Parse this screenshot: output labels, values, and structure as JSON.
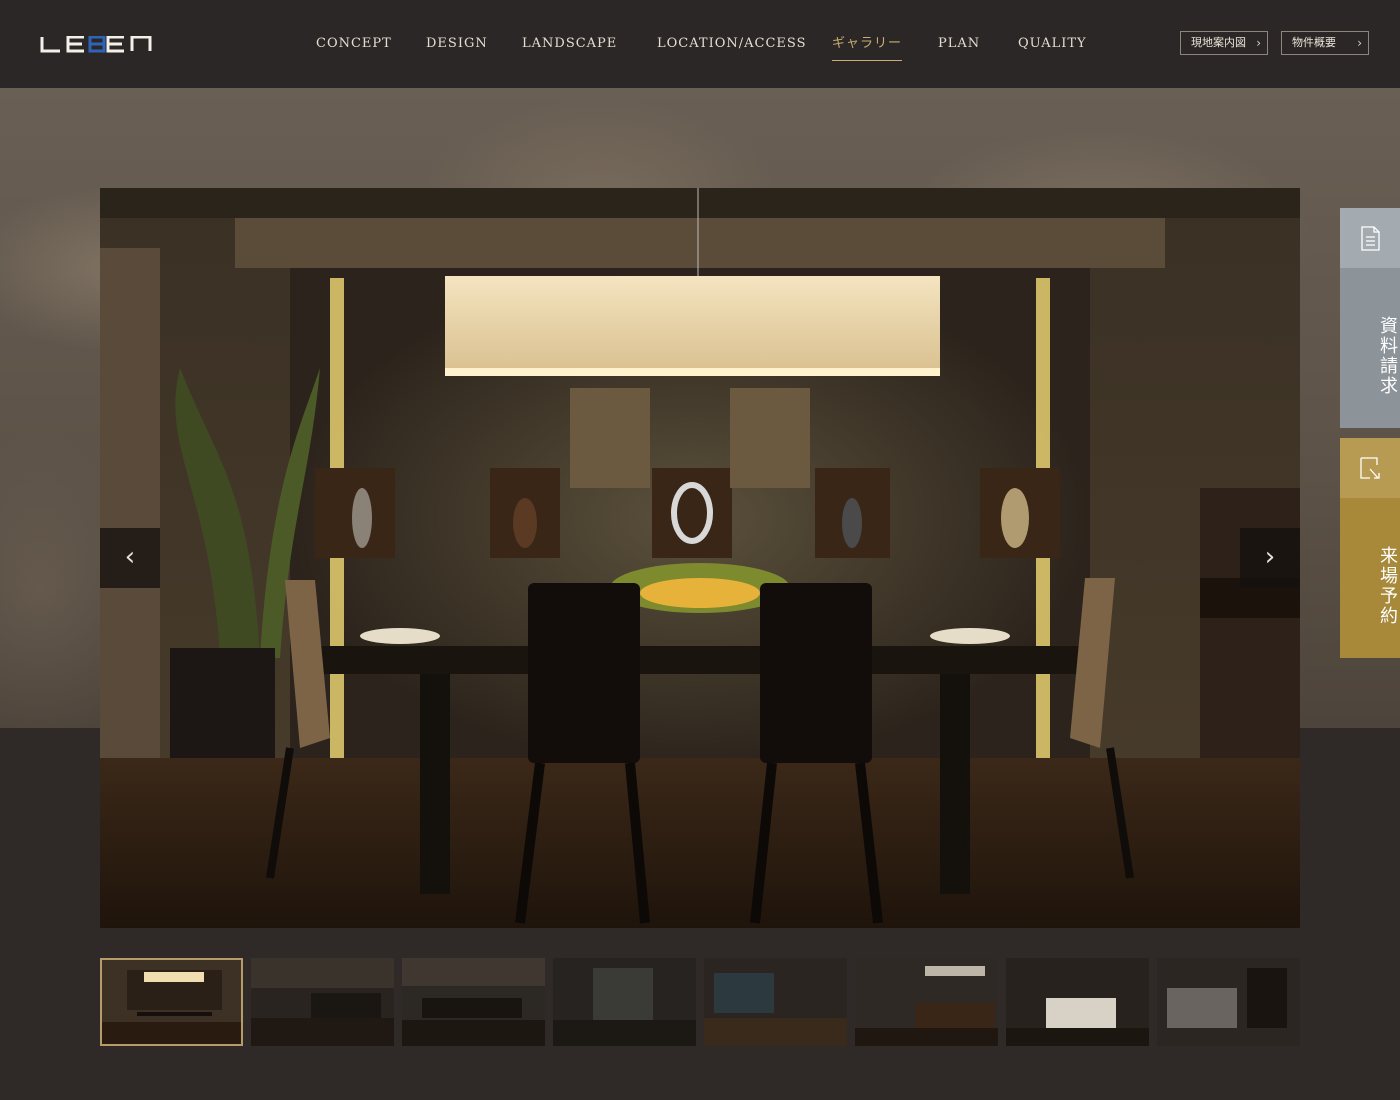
{
  "header": {
    "logo_text": "LEBEN",
    "nav": [
      {
        "label": "CONCEPT"
      },
      {
        "label": "DESIGN"
      },
      {
        "label": "LANDSCAPE"
      },
      {
        "label": "LOCATION/ACCESS"
      },
      {
        "label": "ギャラリー",
        "active": true
      },
      {
        "label": "PLAN"
      },
      {
        "label": "QUALITY"
      }
    ],
    "buttons": {
      "map": "現地案内図",
      "outline": "物件概要"
    }
  },
  "slider": {
    "prev_icon": "chevron-left-icon",
    "next_icon": "chevron-right-icon",
    "active_index": 0,
    "thumbnail_count": 8
  },
  "side_tabs": {
    "request": {
      "label": "資料請求",
      "icon": "document-icon"
    },
    "visit": {
      "label": "来場予約",
      "icon": "reserve-icon"
    }
  },
  "colors": {
    "header_bg": "#2b2726",
    "accent_gold": "#c9ad72",
    "request_tab": "#8c9399",
    "visit_tab": "#a8893a"
  }
}
